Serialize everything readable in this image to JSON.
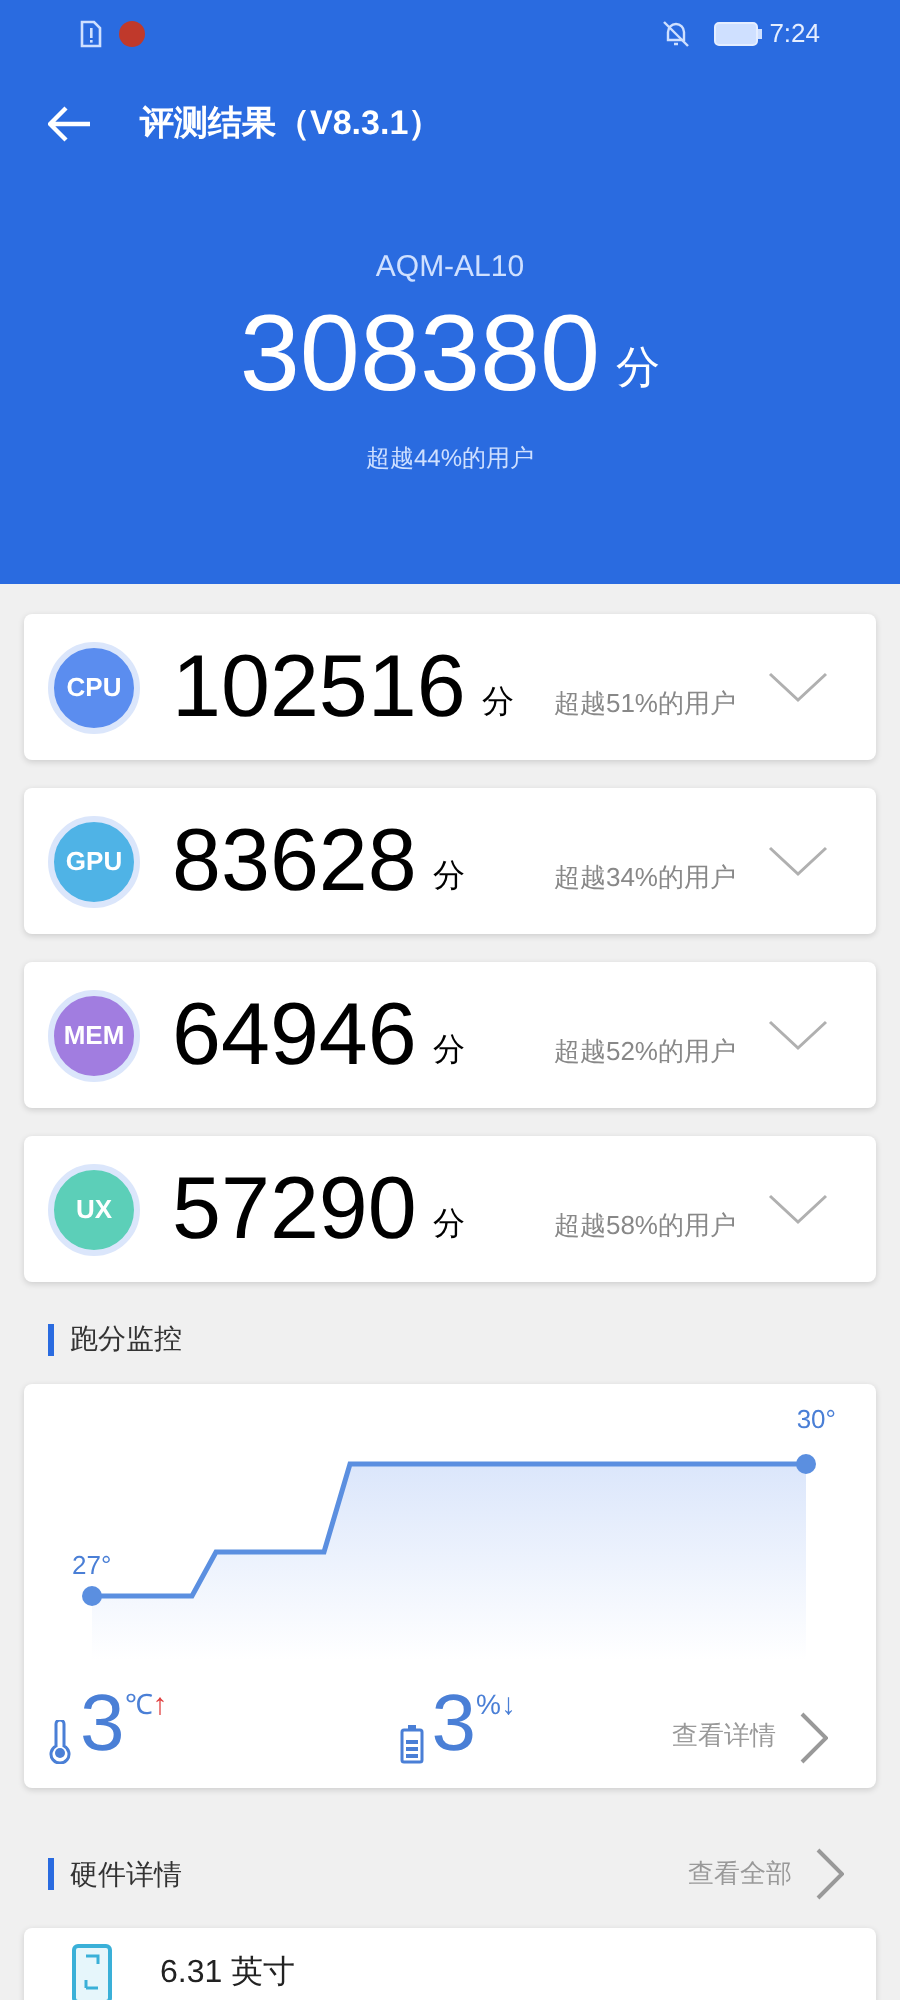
{
  "status_bar": {
    "time": "7:24"
  },
  "header": {
    "title": "评测结果（V8.3.1）",
    "model": "AQM-AL10",
    "score": "308380",
    "unit": "分",
    "rank": "超越44%的用户"
  },
  "categories": [
    {
      "label": "CPU",
      "score": "102516",
      "unit": "分",
      "rank": "超越51%的用户",
      "color": "#5b8def",
      "expanded": false
    },
    {
      "label": "GPU",
      "score": "83628",
      "unit": "分",
      "rank": "超越34%的用户",
      "color": "#4fb3e6",
      "expanded": false
    },
    {
      "label": "MEM",
      "score": "64946",
      "unit": "分",
      "rank": "超越52%的用户",
      "color": "#a17de0",
      "expanded": false
    },
    {
      "label": "UX",
      "score": "57290",
      "unit": "分",
      "rank": "超越58%的用户",
      "color": "#5ccfb8",
      "expanded": false
    }
  ],
  "monitor": {
    "heading": "跑分监控",
    "start_label": "27°",
    "end_label": "30°",
    "temp_value": "3",
    "temp_unit": "℃",
    "temp_arrow": "↑",
    "battery_value": "3",
    "battery_unit": "%",
    "battery_arrow": "↓",
    "link": "查看详情"
  },
  "hardware": {
    "heading": "硬件详情",
    "link": "查看全部",
    "items": [
      {
        "kind": "screen",
        "value": "6.31 英寸"
      }
    ]
  }
}
